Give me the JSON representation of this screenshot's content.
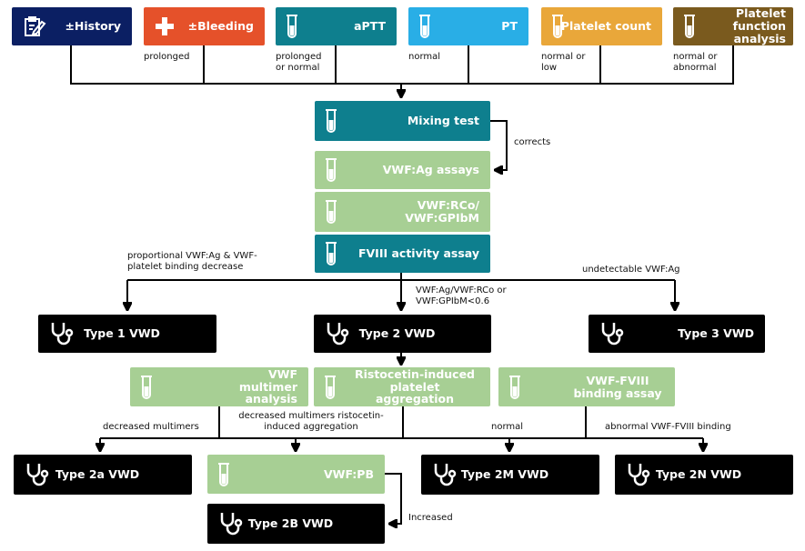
{
  "colors": {
    "history": "#0b1f63",
    "bleeding": "#e5512a",
    "teal": "#0e7f8e",
    "pt": "#29aee6",
    "platelet_count": "#e9a73a",
    "platelet_function": "#7a5a1e",
    "green": "#a7cf94",
    "type": "#000000"
  },
  "top_row": [
    {
      "label": "±History",
      "icon": "clipboard-icon",
      "result": ""
    },
    {
      "label": "±Bleeding",
      "icon": "plus-icon",
      "result": "prolonged"
    },
    {
      "label": "aPTT",
      "icon": "test-tube-icon",
      "result": "prolonged or normal"
    },
    {
      "label": "PT",
      "icon": "test-tube-icon",
      "result": "normal"
    },
    {
      "label": "Platelet count",
      "icon": "test-tube-icon",
      "result": "normal or low"
    },
    {
      "label": "Platelet function analysis",
      "icon": "test-tube-icon",
      "result": "normal or abnormal"
    }
  ],
  "center_tests": {
    "mixing": "Mixing test",
    "vwf_ag": "VWF:Ag assays",
    "vwf_rco": "VWF:RCo/ VWF:GPIbM",
    "fviii": "FVIII activity assay",
    "corrects": "corrects"
  },
  "branch_labels": {
    "type1": "proportional VWF:Ag & VWF-platelet binding decrease",
    "type2": "VWF:Ag/VWF:RCo or VWF:GPIbM<0.6",
    "type3": "undetectable VWF:Ag"
  },
  "types": {
    "type1": "Type 1 VWD",
    "type2": "Type 2 VWD",
    "type3": "Type 3 VWD",
    "type2a": "Type 2a VWD",
    "type2b": "Type 2B VWD",
    "type2m": "Type 2M VWD",
    "type2n": "Type 2N VWD"
  },
  "subtests": {
    "multimer": "VWF multimer analysis",
    "ripa": "Ristocetin-induced platelet aggregation",
    "fviii_binding": "VWF-FVIII binding assay",
    "vwf_pb": "VWF:PB"
  },
  "sub_labels": {
    "decreased_multimers": "decreased multimers",
    "decreased_ripa": "decreased multimers ristocetin-induced aggregation",
    "normal": "normal",
    "abnormal_binding": "abnormal VWF-FVIII binding",
    "increased": "Increased"
  }
}
